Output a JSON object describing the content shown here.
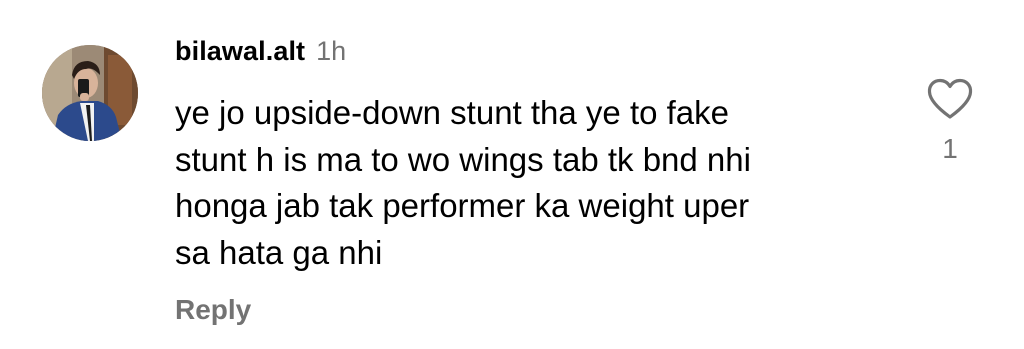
{
  "comment": {
    "username": "bilawal.alt",
    "timestamp": "1h",
    "text": "ye jo upside-down stunt tha ye to fake\nstunt h is ma to wo wings tab tk bnd nhi\nhonga jab tak performer ka weight uper\nsa hata ga nhi",
    "reply_label": "Reply",
    "like_count": "1",
    "like_icon": "heart-outline-icon"
  }
}
